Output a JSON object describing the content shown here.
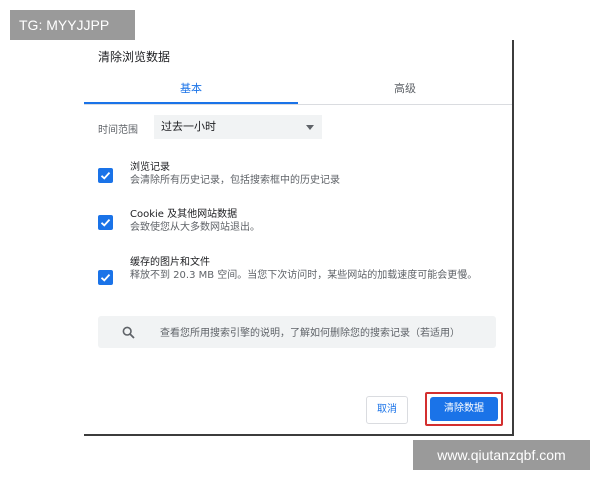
{
  "watermarks": {
    "top_left": "TG: MYYJJPP",
    "bottom_right": "www.qiutanzqbf.com"
  },
  "dialog": {
    "title": "清除浏览数据",
    "tabs": [
      {
        "label": "基本",
        "active": true
      },
      {
        "label": "高级",
        "active": false
      }
    ],
    "time_range": {
      "label": "时间范围",
      "value": "过去一小时"
    },
    "options": [
      {
        "title": "浏览记录",
        "description": "会清除所有历史记录，包括搜索框中的历史记录",
        "checked": true
      },
      {
        "title": "Cookie 及其他网站数据",
        "description": "会致使您从大多数网站退出。",
        "checked": true
      },
      {
        "title": "缓存的图片和文件",
        "description": "释放不到 20.3 MB 空间。当您下次访问时，某些网站的加载速度可能会更慢。",
        "checked": true
      }
    ],
    "search_info": "查看您所用搜索引擎的说明，了解如何删除您的搜索记录（若适用）",
    "buttons": {
      "cancel": "取消",
      "clear": "清除数据"
    }
  },
  "colors": {
    "accent": "#1a73e8",
    "highlight_outline": "#d32f2f",
    "watermark_bg": "#9a9a9a"
  }
}
